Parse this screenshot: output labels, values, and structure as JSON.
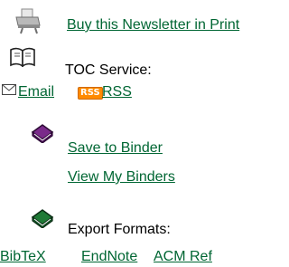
{
  "print": {
    "icon": "printer-icon",
    "label": "Buy this Newsletter in Print"
  },
  "toc": {
    "icon": "book-icon",
    "heading": "TOC Service:",
    "email_icon": "envelope-icon",
    "email_label": "Email",
    "rss_icon": "rss-icon",
    "rss_badge": "RSS",
    "rss_label": "RSS"
  },
  "binder": {
    "icon": "purple-binder-icon",
    "save_label": "Save to Binder",
    "view_label": "View My Binders"
  },
  "export": {
    "icon": "green-binder-icon",
    "heading": "Export Formats:",
    "formats": [
      "BibTeX",
      "EndNote",
      "ACM Ref"
    ]
  },
  "colors": {
    "link": "#006633",
    "binder_purple": "#6a1b7a",
    "binder_green": "#1c6e2e",
    "rss_orange": "#ff8a00"
  }
}
